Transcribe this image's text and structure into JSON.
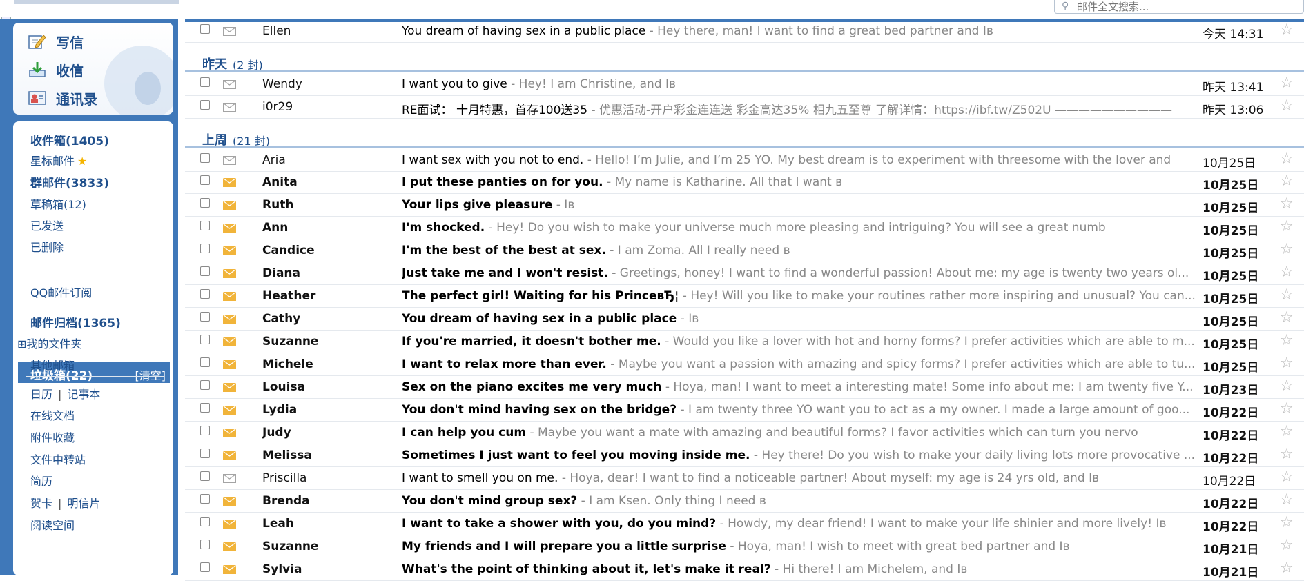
{
  "search": {
    "placeholder": "邮件全文搜索..."
  },
  "quick_actions": [
    {
      "label": "写信",
      "icon": "compose-icon"
    },
    {
      "label": "收信",
      "icon": "inbox-download-icon"
    },
    {
      "label": "通讯录",
      "icon": "contacts-icon"
    }
  ],
  "nav": {
    "inbox": "收件箱(1405)",
    "starred": "星标邮件",
    "group_mail": "群邮件(3833)",
    "drafts": "草稿箱(12)",
    "sent": "已发送",
    "deleted": "已删除",
    "trash": "垃圾箱(22)",
    "trash_clear": "[清空]",
    "qq_subscription": "QQ邮件订阅",
    "archive": "邮件归档(1365)",
    "my_folders": "我的文件夹",
    "my_folders_toggle": "⊞",
    "other_mailboxes": "其他邮箱",
    "calendar": "日历",
    "notes": "记事本",
    "divider": "|",
    "online_docs": "在线文档",
    "attachments": "附件收藏",
    "file_transfer": "文件中转站",
    "resume": "简历",
    "greeting_card": "贺卡",
    "postcard": "明信片",
    "reading_space": "阅读空间"
  },
  "groups": {
    "yesterday": {
      "title": "昨天",
      "count": "(2 封)"
    },
    "last_week": {
      "title": "上周",
      "count": "(21 封)"
    }
  },
  "colors": {
    "accent": "#3f78b9",
    "link": "#1f4f8c",
    "unread_envelope": "#f1b43a",
    "read_envelope": "#a4a4a4"
  },
  "mails": [
    {
      "sender": "Ellen",
      "subject": "You dream of having sex in a public place",
      "preview": " - Hey there, man! I want to find a great bed partner and Iв",
      "date": "今天 14:31",
      "unread": false
    },
    {
      "sender": "Wendy",
      "subject": "I want you to give",
      "preview": " - Hey! I am Christine, and Iв",
      "date": "昨天 13:41",
      "unread": false
    },
    {
      "sender": "i0r29",
      "subject": "RE面试：   十月特惠，首存100送35",
      "preview": " -  优惠活动-开户彩金连连送 彩金高达35% 相九五至尊 了解详情：https://ibf.tw/Z502U ——————————",
      "date": "昨天 13:06",
      "unread": false
    },
    {
      "sender": "Aria",
      "subject": "I want sex with you not to end.",
      "preview": " - Hello! I’m Julie, and I’m 25 YO. My best dream is to experiment with threesome with the lover and",
      "date": "10月25日",
      "unread": false
    },
    {
      "sender": "Anita",
      "subject": "I put these panties on for you.",
      "preview": " - My name is Katharine. All that I want в",
      "date": "10月25日",
      "unread": true
    },
    {
      "sender": "Ruth",
      "subject": "Your lips give pleasure",
      "preview": " - Iв",
      "date": "10月25日",
      "unread": true
    },
    {
      "sender": "Ann",
      "subject": "I'm shocked.",
      "preview": " - Hey! Do you wish to make your universe much more pleasing and intriguing? You will see a great numb",
      "date": "10月25日",
      "unread": true
    },
    {
      "sender": "Candice",
      "subject": "I'm the best of the best at sex.",
      "preview": " - I am Zoma. All I really need в",
      "date": "10月25日",
      "unread": true
    },
    {
      "sender": "Diana",
      "subject": "Just take me and I won't resist.",
      "preview": " - Greetings, honey! I want to find a wonderful passion! About me: my age is twenty two years ol...",
      "date": "10月25日",
      "unread": true
    },
    {
      "sender": "Heather",
      "subject": "The perfect girl! Waiting for his PrinceвЂ¦",
      "preview": " - Hey! Will you like to make your routines rather more inspiring and unusual? You can...",
      "date": "10月25日",
      "unread": true
    },
    {
      "sender": "Cathy",
      "subject": "You dream of having sex in a public place",
      "preview": " - Iв",
      "date": "10月25日",
      "unread": true
    },
    {
      "sender": "Suzanne",
      "subject": "If you're married, it doesn't bother me.",
      "preview": " - Would you like a lover with hot and horny forms? I prefer activities which are able to m...",
      "date": "10月25日",
      "unread": true
    },
    {
      "sender": "Michele",
      "subject": "I want to relax more than ever.",
      "preview": " - Maybe you want a passion with amazing and spicy forms? I prefer activities which are able to tu...",
      "date": "10月25日",
      "unread": true
    },
    {
      "sender": "Louisa",
      "subject": "Sex on the piano excites me very much",
      "preview": " - Hoya, man! I want to meet a interesting mate! Some info about me: I am twenty five Y...",
      "date": "10月23日",
      "unread": true
    },
    {
      "sender": "Lydia",
      "subject": "You don't mind having sex on the bridge?",
      "preview": " - I am twenty three YO want you to act as a my owner. I made a large amount of goo...",
      "date": "10月22日",
      "unread": true
    },
    {
      "sender": "Judy",
      "subject": "I can help you cum",
      "preview": " - Maybe you want a mate with amazing and beautiful forms? I favor activities which can turn you nervo",
      "date": "10月22日",
      "unread": true
    },
    {
      "sender": "Melissa",
      "subject": "Sometimes I just want to feel you moving inside me.",
      "preview": " - Hey there! Do you wish to make your daily living lots more provocative ...",
      "date": "10月22日",
      "unread": true
    },
    {
      "sender": "Priscilla",
      "subject": "I want to smell you on me.",
      "preview": " - Hoya, dear! I want to find a noticeable partner! About myself: my age is 24 yrs old, and Iв",
      "date": "10月22日",
      "unread": false
    },
    {
      "sender": "Brenda",
      "subject": "You don't mind group sex?",
      "preview": " - I am Ksen. Only thing I need в",
      "date": "10月22日",
      "unread": true
    },
    {
      "sender": "Leah",
      "subject": "I want to take a shower with you, do you mind?",
      "preview": " - Howdy, my dear friend! I want to make your life shinier and more lively! Iв",
      "date": "10月22日",
      "unread": true
    },
    {
      "sender": "Suzanne",
      "subject": "My friends and I will prepare you a little surprise",
      "preview": " - Hoya, man! I wish to meet with great bed partner and Iв",
      "date": "10月21日",
      "unread": true
    },
    {
      "sender": "Sylvia",
      "subject": "What's the point of thinking about it, let's make it real?",
      "preview": " - Hi there! I am Michelem, and Iв",
      "date": "10月21日",
      "unread": true
    }
  ]
}
